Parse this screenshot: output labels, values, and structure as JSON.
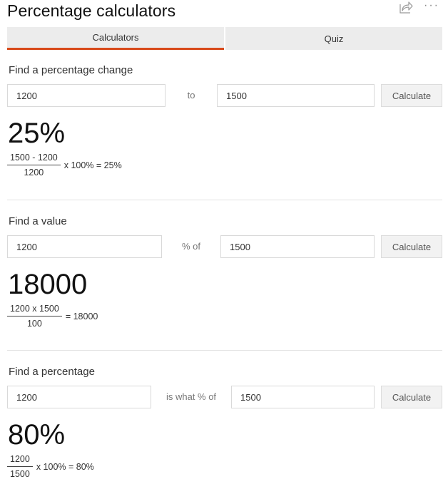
{
  "header": {
    "title": "Percentage calculators",
    "share_icon": "share-icon",
    "more_icon": "more-options-icon",
    "more_glyph": "···"
  },
  "tabs": [
    {
      "label": "Calculators",
      "active": true
    },
    {
      "label": "Quiz",
      "active": false
    }
  ],
  "accent_color": "#d84a1b",
  "sections": [
    {
      "label": "Find a percentage change",
      "input1": "1200",
      "connector": "to",
      "input2": "1500",
      "button": "Calculate",
      "result": "25%",
      "formula": {
        "numerator": "1500 - 1200",
        "denominator": "1200",
        "rest": "x 100% = 25%"
      }
    },
    {
      "label": "Find a value",
      "input1": "1200",
      "connector": "% of",
      "input2": "1500",
      "button": "Calculate",
      "result": "18000",
      "formula": {
        "numerator": "1200 x 1500",
        "denominator": "100",
        "rest": "= 18000"
      }
    },
    {
      "label": "Find a percentage",
      "input1": "1200",
      "connector": "is what % of",
      "input2": "1500",
      "button": "Calculate",
      "result": "80%",
      "formula": {
        "numerator": "1200",
        "denominator": "1500",
        "rest": "x 100% = 80%"
      }
    }
  ]
}
